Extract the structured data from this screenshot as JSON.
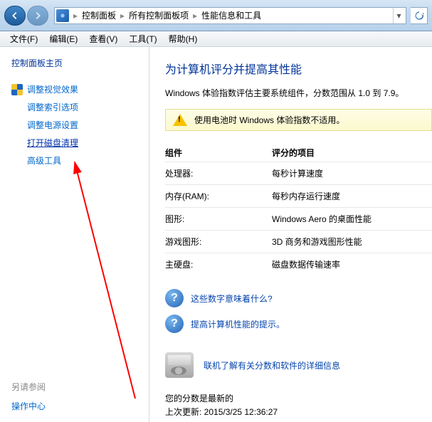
{
  "titlebar": {
    "breadcrumbs": [
      "控制面板",
      "所有控制面板项",
      "性能信息和工具"
    ]
  },
  "menu": {
    "file": "文件(F)",
    "edit": "编辑(E)",
    "view": "查看(V)",
    "tools": "工具(T)",
    "help": "帮助(H)"
  },
  "sidebar": {
    "heading": "控制面板主页",
    "links": [
      {
        "label": "调整视觉效果",
        "shield": true
      },
      {
        "label": "调整索引选项"
      },
      {
        "label": "调整电源设置"
      },
      {
        "label": "打开磁盘清理",
        "selected": true
      },
      {
        "label": "高级工具"
      }
    ],
    "see_also": "另请参阅",
    "action_center": "操作中心"
  },
  "main": {
    "title": "为计算机评分并提高其性能",
    "desc": "Windows 体验指数评估主要系统组件，分数范围从 1.0 到 7.9。",
    "alert": "使用电池时 Windows 体验指数不适用。",
    "th1": "组件",
    "th2": "评分的项目",
    "rows": [
      {
        "c1": "处理器:",
        "c2": "每秒计算速度"
      },
      {
        "c1": "内存(RAM):",
        "c2": "每秒内存运行速度"
      },
      {
        "c1": "图形:",
        "c2": "Windows Aero 的桌面性能"
      },
      {
        "c1": "游戏图形:",
        "c2": "3D 商务和游戏图形性能"
      },
      {
        "c1": "主硬盘:",
        "c2": "磁盘数据传输速率"
      }
    ],
    "help1": "这些数字意味着什么?",
    "help2": "提高计算机性能的提示。",
    "info_link": "联机了解有关分数和软件的详细信息",
    "status1": "您的分数是最新的",
    "status2": "上次更新: 2015/3/25 12:36:27"
  }
}
